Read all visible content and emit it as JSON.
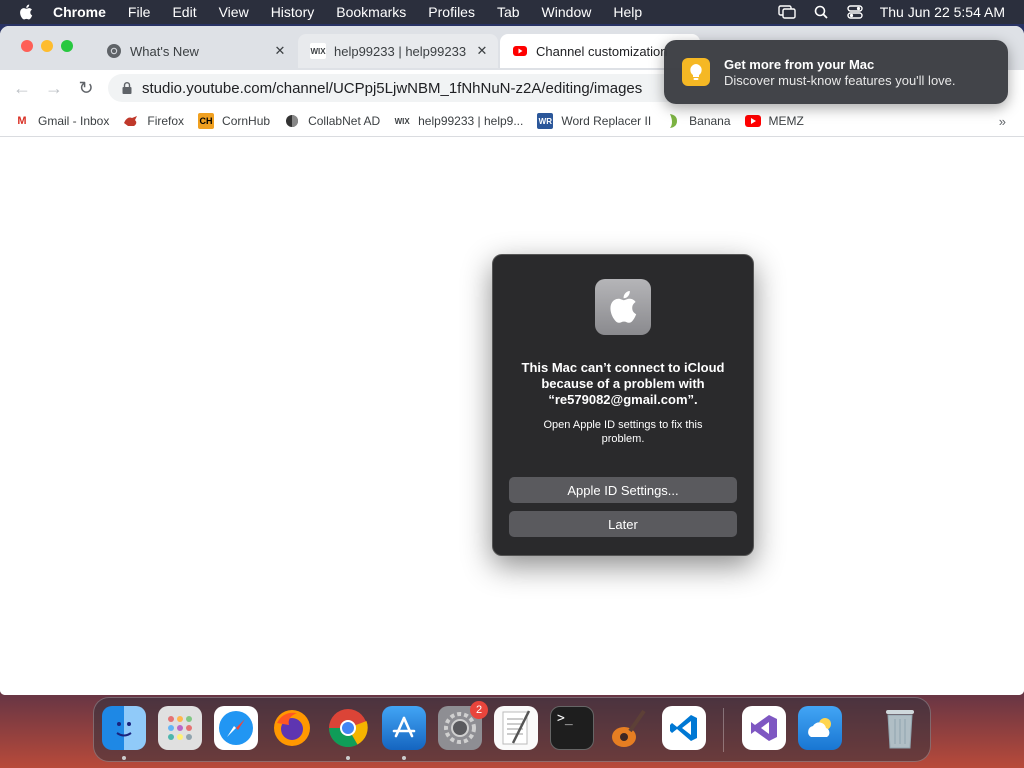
{
  "menubar": {
    "app_name": "Chrome",
    "items": [
      "File",
      "Edit",
      "View",
      "History",
      "Bookmarks",
      "Profiles",
      "Tab",
      "Window",
      "Help"
    ],
    "clock": "Thu Jun 22  5:54 AM",
    "icons": [
      "screen-mirroring-icon",
      "spotlight-search-icon",
      "control-center-icon"
    ]
  },
  "tabs": [
    {
      "title": "What's New",
      "favicon": "chrome-icon",
      "state": "inactive"
    },
    {
      "title": "help99233 | help99233",
      "favicon": "wix-icon",
      "state": "hover"
    },
    {
      "title": "Channel customization",
      "favicon": "youtube-icon",
      "state": "active"
    }
  ],
  "toolbar": {
    "url": "studio.youtube.com/channel/UCPpj5LjwNBM_1fNhNuN-z2A/editing/images"
  },
  "bookmarks": [
    {
      "label": "Gmail - Inbox",
      "icon": "gmail-icon",
      "glyph": "M",
      "color": "#d93025"
    },
    {
      "label": "Firefox",
      "icon": "firefox-bookmark-icon",
      "glyph": "🦊",
      "color": "#c0392b"
    },
    {
      "label": "CornHub",
      "icon": "cornhub-icon",
      "glyph": "CH",
      "color": "#f0a020"
    },
    {
      "label": "CollabNet AD",
      "icon": "collabnet-icon",
      "glyph": "◐",
      "color": "#333333"
    },
    {
      "label": "help99233 | help9...",
      "icon": "wix-icon",
      "glyph": "wix",
      "color": "#000000"
    },
    {
      "label": "Word Replacer II",
      "icon": "word-replacer-icon",
      "glyph": "WR",
      "color": "#2b579a"
    },
    {
      "label": "Banana",
      "icon": "banana-icon",
      "glyph": "🍌",
      "color": "#7cb342"
    },
    {
      "label": "MEMZ",
      "icon": "youtube-icon",
      "glyph": "▶",
      "color": "#ff0000"
    }
  ],
  "notification": {
    "title": "Get more from your Mac",
    "body": "Discover must-know features you'll love.",
    "icon": "tips-lightbulb-icon"
  },
  "dialog": {
    "icon": "apple-logo-icon",
    "title": "This Mac can’t connect to iCloud because of a problem with “re579082@gmail.com”.",
    "message": "Open Apple ID settings to fix this problem.",
    "primary_button": "Apple ID Settings...",
    "secondary_button": "Later"
  },
  "dock": {
    "apps": [
      {
        "name": "Finder",
        "icon": "finder-icon",
        "running": true
      },
      {
        "name": "Launchpad",
        "icon": "launchpad-icon",
        "running": false
      },
      {
        "name": "Safari",
        "icon": "safari-icon",
        "running": false
      },
      {
        "name": "Firefox",
        "icon": "firefox-icon",
        "running": false
      },
      {
        "name": "Chrome",
        "icon": "chrome-icon",
        "running": true
      },
      {
        "name": "App Store",
        "icon": "app-store-icon",
        "running": true
      },
      {
        "name": "System Settings",
        "icon": "system-settings-icon",
        "running": false,
        "badge": "2"
      },
      {
        "name": "TextEdit",
        "icon": "textedit-icon",
        "running": false
      },
      {
        "name": "Terminal",
        "icon": "terminal-icon",
        "running": false
      },
      {
        "name": "GarageBand",
        "icon": "garageband-icon",
        "running": false
      },
      {
        "name": "VS Code",
        "icon": "vscode-icon",
        "running": false
      },
      {
        "name": "Visual Studio",
        "icon": "visual-studio-icon",
        "running": false
      },
      {
        "name": "Weather",
        "icon": "weather-icon",
        "running": false
      },
      {
        "name": "Trash",
        "icon": "trash-icon",
        "running": false
      }
    ]
  }
}
